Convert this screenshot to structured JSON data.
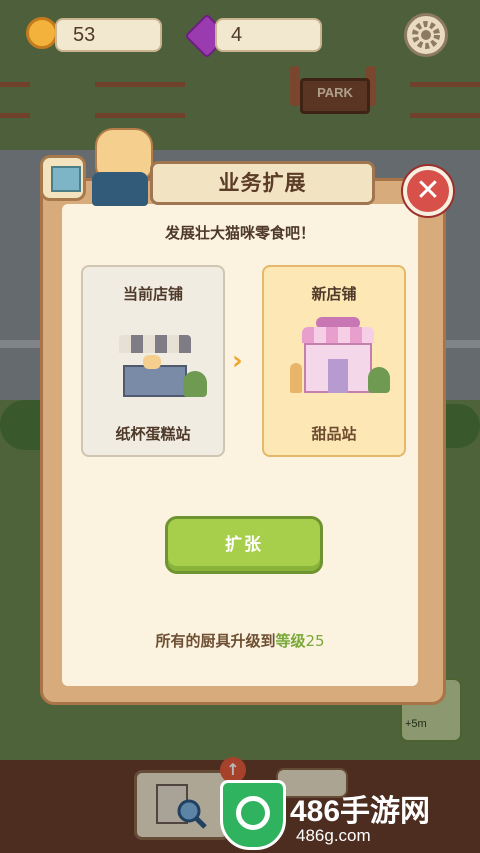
{
  "hud": {
    "coins": "53",
    "gems": "4",
    "coin_icon": "coin-icon",
    "gem_icon": "gem-icon",
    "settings_icon": "gear-icon"
  },
  "scene": {
    "park_sign": "PARK",
    "timer": "+5m"
  },
  "dialog": {
    "title": "业务扩展",
    "subtitle": "发展壮大猫咪零食吧！",
    "current_shop": {
      "heading": "当前店铺",
      "name": "纸杯蛋糕站"
    },
    "new_shop": {
      "heading": "新店铺",
      "name": "甜品站"
    },
    "expand_button": "扩张",
    "requirement_prefix": "所有的厨具升级到",
    "requirement_level_word": "等级",
    "requirement_level": "25",
    "close_icon": "close-icon",
    "arrow_icon": "chevron-right-icon"
  },
  "watermark": {
    "title": "486手游网",
    "url": "486g.com"
  },
  "colors": {
    "expand_button": "#a8cf4c",
    "close_button": "#d8504a",
    "panel": "#fbf3df",
    "new_card": "#fde7b4",
    "level_text": "#7aa83a"
  }
}
